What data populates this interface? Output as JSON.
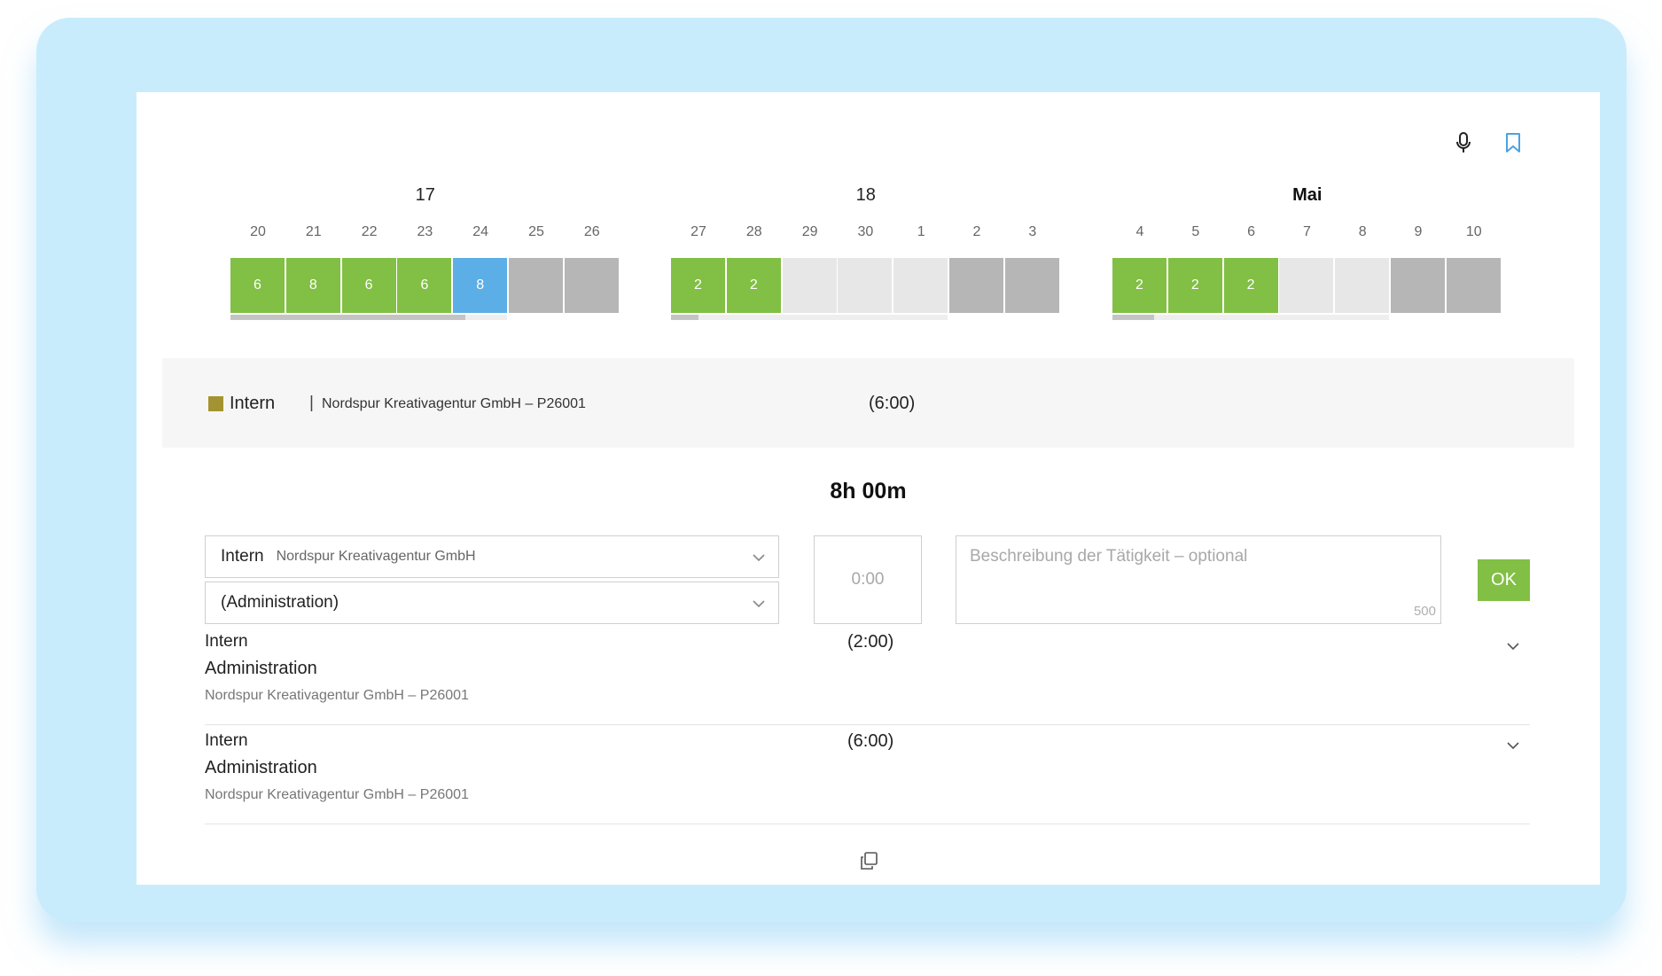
{
  "weeks": [
    {
      "label": "17",
      "bold": false,
      "days": [
        {
          "num": "20",
          "hours": "6",
          "state": "green"
        },
        {
          "num": "21",
          "hours": "8",
          "state": "green"
        },
        {
          "num": "22",
          "hours": "6",
          "state": "green"
        },
        {
          "num": "23",
          "hours": "6",
          "state": "green"
        },
        {
          "num": "24",
          "hours": "8",
          "state": "blue"
        },
        {
          "num": "25",
          "hours": "",
          "state": "gray"
        },
        {
          "num": "26",
          "hours": "",
          "state": "gray"
        }
      ],
      "progress": 0.85
    },
    {
      "label": "18",
      "bold": false,
      "days": [
        {
          "num": "27",
          "hours": "2",
          "state": "green"
        },
        {
          "num": "28",
          "hours": "2",
          "state": "green"
        },
        {
          "num": "29",
          "hours": "",
          "state": "light"
        },
        {
          "num": "30",
          "hours": "",
          "state": "light"
        },
        {
          "num": "1",
          "hours": "",
          "state": "light"
        },
        {
          "num": "2",
          "hours": "",
          "state": "gray"
        },
        {
          "num": "3",
          "hours": "",
          "state": "gray"
        }
      ],
      "progress": 0.1
    },
    {
      "label": "Mai",
      "bold": true,
      "days": [
        {
          "num": "4",
          "hours": "2",
          "state": "green"
        },
        {
          "num": "5",
          "hours": "2",
          "state": "green"
        },
        {
          "num": "6",
          "hours": "2",
          "state": "green"
        },
        {
          "num": "7",
          "hours": "",
          "state": "light"
        },
        {
          "num": "8",
          "hours": "",
          "state": "light"
        },
        {
          "num": "9",
          "hours": "",
          "state": "gray"
        },
        {
          "num": "10",
          "hours": "",
          "state": "gray"
        }
      ],
      "progress": 0.15
    }
  ],
  "summary": {
    "category": "Intern",
    "separator": "|",
    "project": "Nordspur Kreativagentur GmbH – P26001",
    "duration": "(6:00)",
    "color": "#a49431"
  },
  "total": "8h 00m",
  "form": {
    "category_select": {
      "main": "Intern",
      "sub": "Nordspur Kreativagentur GmbH"
    },
    "task_select": {
      "main": "(Administration)"
    },
    "time_value": "0:00",
    "description_placeholder": "Beschreibung der Tätigkeit – optional",
    "char_count": "500",
    "ok_label": "OK"
  },
  "entries": [
    {
      "category": "Intern",
      "task": "Administration",
      "project": "Nordspur Kreativagentur GmbH – P26001",
      "duration": "(2:00)"
    },
    {
      "category": "Intern",
      "task": "Administration",
      "project": "Nordspur Kreativagentur GmbH – P26001",
      "duration": "(6:00)"
    }
  ],
  "colors": {
    "green": "#82bf45",
    "blue": "#5caee6",
    "light": "#e7e7e7",
    "gray": "#b6b6b6",
    "frame": "#c9ecfc",
    "bookmark": "#4aa3e0"
  },
  "icons": {
    "top": [
      "microphone-icon",
      "bookmark-icon"
    ],
    "entry": "chevron-down-icon",
    "footer": "copy-icon"
  }
}
